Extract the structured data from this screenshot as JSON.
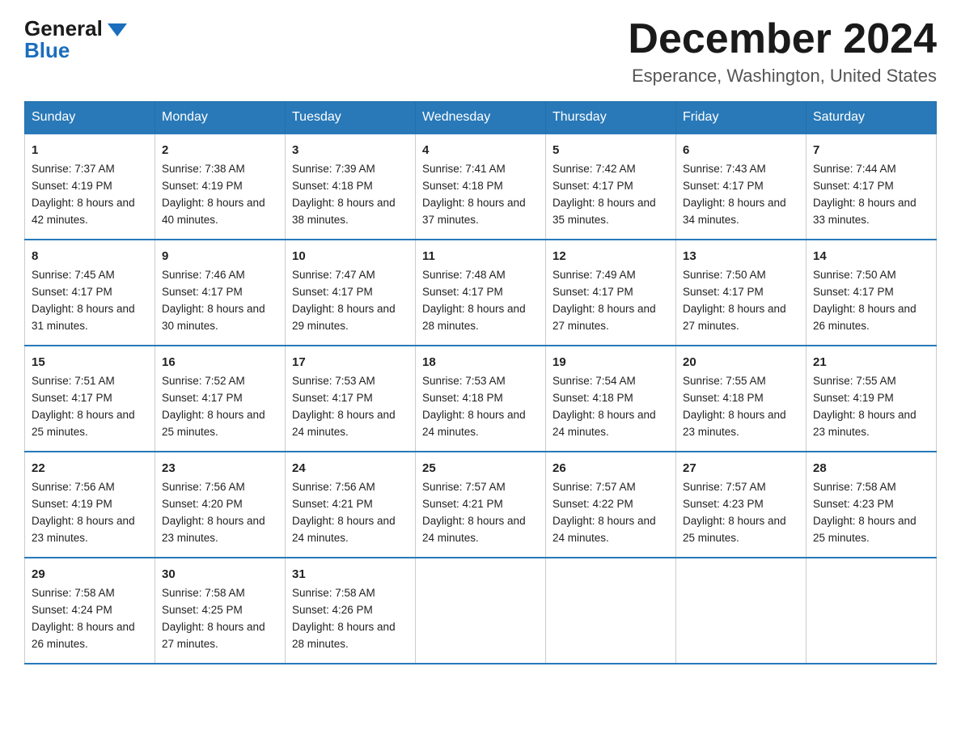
{
  "header": {
    "logo_general": "General",
    "logo_blue": "Blue",
    "month_title": "December 2024",
    "location": "Esperance, Washington, United States"
  },
  "days_of_week": [
    "Sunday",
    "Monday",
    "Tuesday",
    "Wednesday",
    "Thursday",
    "Friday",
    "Saturday"
  ],
  "weeks": [
    [
      {
        "num": "1",
        "sunrise": "7:37 AM",
        "sunset": "4:19 PM",
        "daylight": "8 hours and 42 minutes."
      },
      {
        "num": "2",
        "sunrise": "7:38 AM",
        "sunset": "4:19 PM",
        "daylight": "8 hours and 40 minutes."
      },
      {
        "num": "3",
        "sunrise": "7:39 AM",
        "sunset": "4:18 PM",
        "daylight": "8 hours and 38 minutes."
      },
      {
        "num": "4",
        "sunrise": "7:41 AM",
        "sunset": "4:18 PM",
        "daylight": "8 hours and 37 minutes."
      },
      {
        "num": "5",
        "sunrise": "7:42 AM",
        "sunset": "4:17 PM",
        "daylight": "8 hours and 35 minutes."
      },
      {
        "num": "6",
        "sunrise": "7:43 AM",
        "sunset": "4:17 PM",
        "daylight": "8 hours and 34 minutes."
      },
      {
        "num": "7",
        "sunrise": "7:44 AM",
        "sunset": "4:17 PM",
        "daylight": "8 hours and 33 minutes."
      }
    ],
    [
      {
        "num": "8",
        "sunrise": "7:45 AM",
        "sunset": "4:17 PM",
        "daylight": "8 hours and 31 minutes."
      },
      {
        "num": "9",
        "sunrise": "7:46 AM",
        "sunset": "4:17 PM",
        "daylight": "8 hours and 30 minutes."
      },
      {
        "num": "10",
        "sunrise": "7:47 AM",
        "sunset": "4:17 PM",
        "daylight": "8 hours and 29 minutes."
      },
      {
        "num": "11",
        "sunrise": "7:48 AM",
        "sunset": "4:17 PM",
        "daylight": "8 hours and 28 minutes."
      },
      {
        "num": "12",
        "sunrise": "7:49 AM",
        "sunset": "4:17 PM",
        "daylight": "8 hours and 27 minutes."
      },
      {
        "num": "13",
        "sunrise": "7:50 AM",
        "sunset": "4:17 PM",
        "daylight": "8 hours and 27 minutes."
      },
      {
        "num": "14",
        "sunrise": "7:50 AM",
        "sunset": "4:17 PM",
        "daylight": "8 hours and 26 minutes."
      }
    ],
    [
      {
        "num": "15",
        "sunrise": "7:51 AM",
        "sunset": "4:17 PM",
        "daylight": "8 hours and 25 minutes."
      },
      {
        "num": "16",
        "sunrise": "7:52 AM",
        "sunset": "4:17 PM",
        "daylight": "8 hours and 25 minutes."
      },
      {
        "num": "17",
        "sunrise": "7:53 AM",
        "sunset": "4:17 PM",
        "daylight": "8 hours and 24 minutes."
      },
      {
        "num": "18",
        "sunrise": "7:53 AM",
        "sunset": "4:18 PM",
        "daylight": "8 hours and 24 minutes."
      },
      {
        "num": "19",
        "sunrise": "7:54 AM",
        "sunset": "4:18 PM",
        "daylight": "8 hours and 24 minutes."
      },
      {
        "num": "20",
        "sunrise": "7:55 AM",
        "sunset": "4:18 PM",
        "daylight": "8 hours and 23 minutes."
      },
      {
        "num": "21",
        "sunrise": "7:55 AM",
        "sunset": "4:19 PM",
        "daylight": "8 hours and 23 minutes."
      }
    ],
    [
      {
        "num": "22",
        "sunrise": "7:56 AM",
        "sunset": "4:19 PM",
        "daylight": "8 hours and 23 minutes."
      },
      {
        "num": "23",
        "sunrise": "7:56 AM",
        "sunset": "4:20 PM",
        "daylight": "8 hours and 23 minutes."
      },
      {
        "num": "24",
        "sunrise": "7:56 AM",
        "sunset": "4:21 PM",
        "daylight": "8 hours and 24 minutes."
      },
      {
        "num": "25",
        "sunrise": "7:57 AM",
        "sunset": "4:21 PM",
        "daylight": "8 hours and 24 minutes."
      },
      {
        "num": "26",
        "sunrise": "7:57 AM",
        "sunset": "4:22 PM",
        "daylight": "8 hours and 24 minutes."
      },
      {
        "num": "27",
        "sunrise": "7:57 AM",
        "sunset": "4:23 PM",
        "daylight": "8 hours and 25 minutes."
      },
      {
        "num": "28",
        "sunrise": "7:58 AM",
        "sunset": "4:23 PM",
        "daylight": "8 hours and 25 minutes."
      }
    ],
    [
      {
        "num": "29",
        "sunrise": "7:58 AM",
        "sunset": "4:24 PM",
        "daylight": "8 hours and 26 minutes."
      },
      {
        "num": "30",
        "sunrise": "7:58 AM",
        "sunset": "4:25 PM",
        "daylight": "8 hours and 27 minutes."
      },
      {
        "num": "31",
        "sunrise": "7:58 AM",
        "sunset": "4:26 PM",
        "daylight": "8 hours and 28 minutes."
      },
      null,
      null,
      null,
      null
    ]
  ]
}
